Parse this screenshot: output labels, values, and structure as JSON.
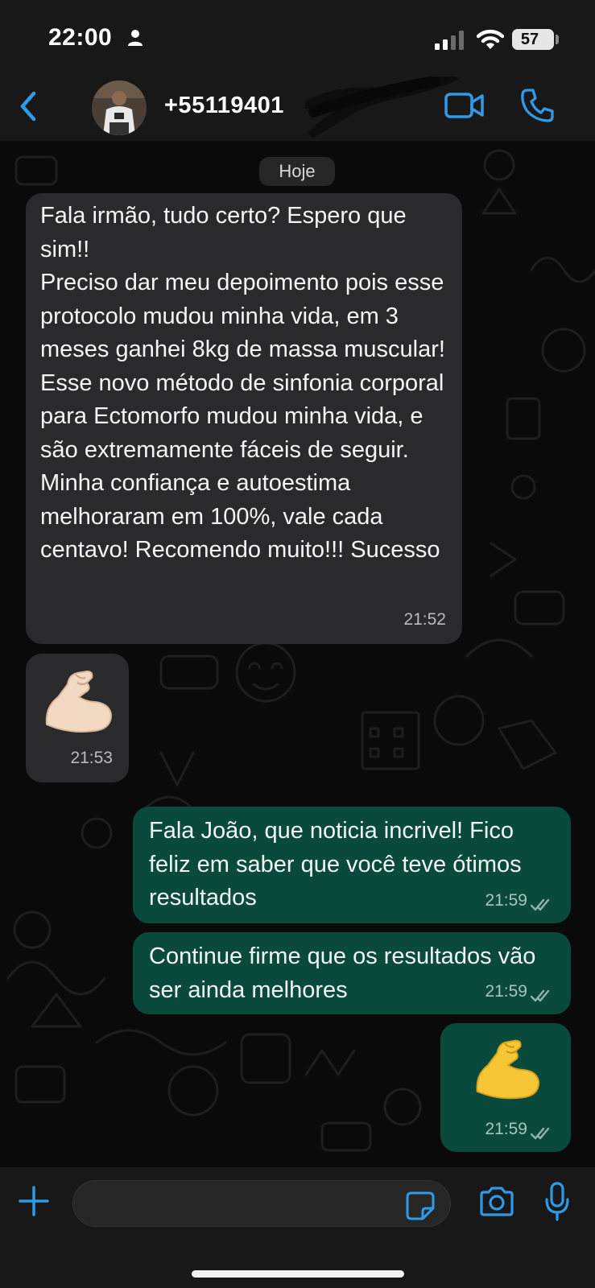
{
  "status_bar": {
    "time": "22:00",
    "battery": "57",
    "icons": [
      "person-icon",
      "signal-icon",
      "wifi-icon",
      "battery-icon"
    ]
  },
  "header": {
    "back_icon": "chevron-left-icon",
    "contact_name": "+55119401",
    "actions": [
      "video-call-icon",
      "phone-icon"
    ]
  },
  "chat": {
    "date_separator": "Hoje",
    "messages": [
      {
        "direction": "incoming",
        "text": "Fala irmão, tudo certo? Espero que sim!!\nPreciso dar meu depoimento pois esse protocolo mudou minha vida, em 3 meses ganhei 8kg de massa muscular! Esse novo método de sinfonia corporal para Ectomorfo mudou minha vida, e são extremamente fáceis de seguir. Minha confiança e autoestima melhoraram em 100%, vale cada centavo! Recomendo muito!!! Sucesso",
        "time": "21:52"
      },
      {
        "direction": "incoming",
        "emoji": "flexed-biceps-light-skin",
        "time": "21:53"
      },
      {
        "direction": "outgoing",
        "text": "Fala João, que noticia incrivel! Fico feliz em saber que você teve ótimos resultados",
        "time": "21:59",
        "status": "read"
      },
      {
        "direction": "outgoing",
        "text": "Continue firme que os resultados vão ser ainda melhores",
        "time": "21:59",
        "status": "read"
      },
      {
        "direction": "outgoing",
        "emoji": "flexed-biceps-yellow",
        "time": "21:59",
        "status": "read"
      }
    ]
  },
  "input_bar": {
    "message_value": "",
    "icons": [
      "plus-icon",
      "sticker-icon",
      "camera-icon",
      "microphone-icon"
    ]
  },
  "colors": {
    "accent": "#2f9be8",
    "incoming_bubble": "#2a2a2c",
    "outgoing_bubble": "#0a4a3c",
    "background": "#0a0a0a",
    "bar": "#181818"
  }
}
